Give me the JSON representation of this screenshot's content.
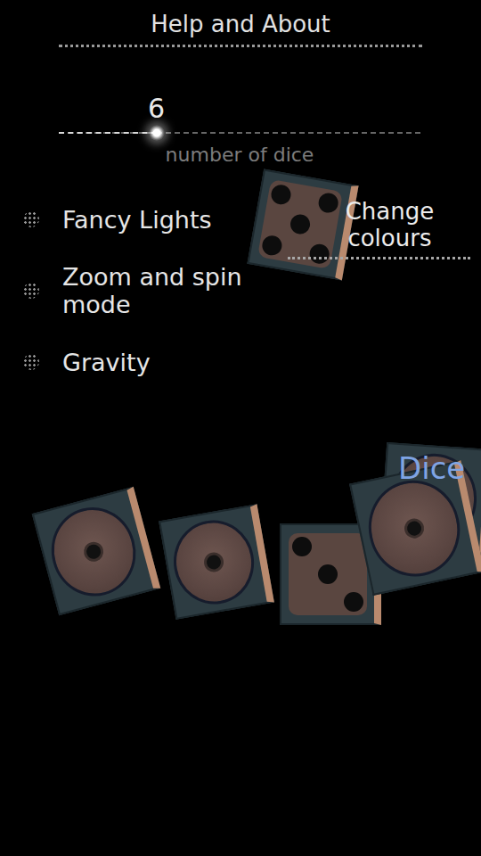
{
  "title": "Help and About",
  "slider": {
    "value": "6",
    "label": "number of dice",
    "level": 0.27
  },
  "options": [
    {
      "label": "Fancy Lights",
      "checked": false
    },
    {
      "label": "Zoom and spin mode",
      "checked": false
    },
    {
      "label": "Gravity",
      "checked": false
    }
  ],
  "button": "Change colours",
  "overlay_label": "Dice",
  "dice": [
    {
      "pips": 5
    },
    {
      "pips": 1
    },
    {
      "pips": 1
    },
    {
      "pips": 3
    },
    {
      "pips": 1
    },
    {
      "pips": 1
    }
  ]
}
